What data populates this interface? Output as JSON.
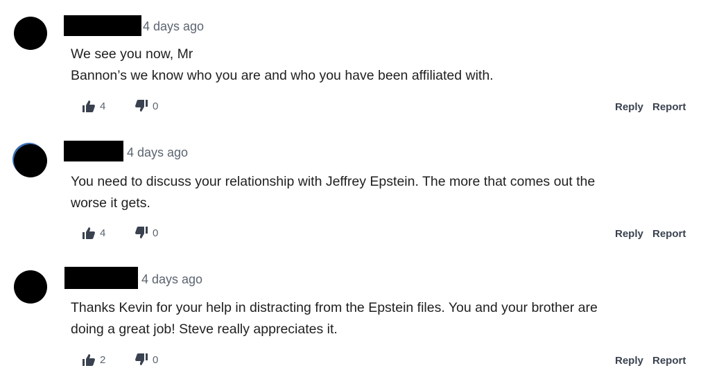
{
  "comments": [
    {
      "time": "4 days ago",
      "lines": [
        "We see you now, Mr",
        "Bannon’s we know who you are and who you have been affiliated with."
      ],
      "likes": "4",
      "dislikes": "0",
      "reply_label": "Reply",
      "report_label": "Report"
    },
    {
      "time": "4 days ago",
      "lines": [
        "You need to discuss your relationship with Jeffrey Epstein. The more that comes out the",
        "worse it gets."
      ],
      "likes": "4",
      "dislikes": "0",
      "reply_label": "Reply",
      "report_label": "Report"
    },
    {
      "time": "4 days ago",
      "lines": [
        "Thanks Kevin for your help in distracting from the Epstein files. You and your brother are",
        "doing a great job! Steve really appreciates it."
      ],
      "likes": "2",
      "dislikes": "0",
      "reply_label": "Reply",
      "report_label": "Report"
    }
  ],
  "icons": {
    "like": "thumbs-up-icon",
    "dislike": "thumbs-down-icon"
  },
  "colors": {
    "text": "#1f1f1f",
    "muted": "#5b6470",
    "redaction": "#000000",
    "avatar_ring": "#3b6fb6"
  }
}
